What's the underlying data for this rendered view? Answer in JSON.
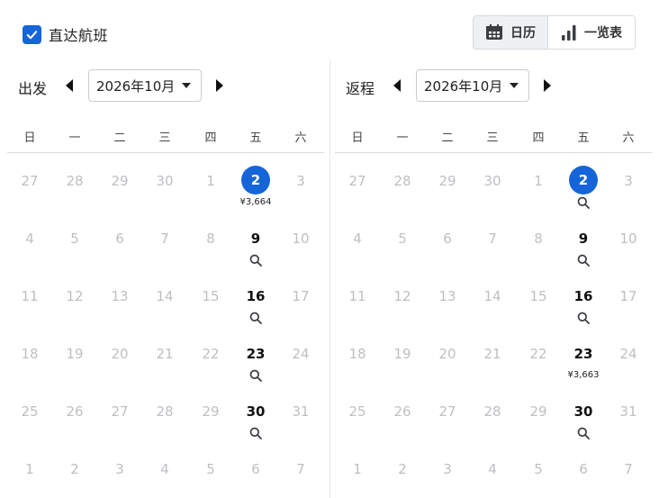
{
  "direct_flight": {
    "label": "直达航班",
    "checked": true
  },
  "view_toggle": {
    "calendar_label": "日历",
    "list_label": "一览表",
    "active": "calendar"
  },
  "weekdays": [
    "日",
    "一",
    "二",
    "三",
    "四",
    "五",
    "六"
  ],
  "panels": [
    {
      "label": "出发",
      "month": "2026年10月",
      "weeks": [
        [
          "27",
          "28",
          "29",
          "30",
          "1",
          "2",
          "3"
        ],
        [
          "4",
          "5",
          "6",
          "7",
          "8",
          "9",
          "10"
        ],
        [
          "11",
          "12",
          "13",
          "14",
          "15",
          "16",
          "17"
        ],
        [
          "18",
          "19",
          "20",
          "21",
          "22",
          "23",
          "24"
        ],
        [
          "25",
          "26",
          "27",
          "28",
          "29",
          "30",
          "31"
        ],
        [
          "1",
          "2",
          "3",
          "4",
          "5",
          "6",
          "7"
        ]
      ],
      "available": [
        [
          0,
          5
        ],
        [
          1,
          5
        ],
        [
          2,
          5
        ],
        [
          3,
          5
        ],
        [
          4,
          5
        ]
      ],
      "selected": [
        0,
        5
      ],
      "prices": [
        {
          "cell": [
            0,
            5
          ],
          "text": "¥3,664"
        }
      ]
    },
    {
      "label": "返程",
      "month": "2026年10月",
      "weeks": [
        [
          "27",
          "28",
          "29",
          "30",
          "1",
          "2",
          "3"
        ],
        [
          "4",
          "5",
          "6",
          "7",
          "8",
          "9",
          "10"
        ],
        [
          "11",
          "12",
          "13",
          "14",
          "15",
          "16",
          "17"
        ],
        [
          "18",
          "19",
          "20",
          "21",
          "22",
          "23",
          "24"
        ],
        [
          "25",
          "26",
          "27",
          "28",
          "29",
          "30",
          "31"
        ],
        [
          "1",
          "2",
          "3",
          "4",
          "5",
          "6",
          "7"
        ]
      ],
      "available": [
        [
          0,
          5
        ],
        [
          1,
          5
        ],
        [
          2,
          5
        ],
        [
          3,
          5
        ],
        [
          4,
          5
        ]
      ],
      "selected": [
        0,
        5
      ],
      "prices": [
        {
          "cell": [
            3,
            5
          ],
          "text": "¥3,663"
        }
      ]
    }
  ],
  "icons": {
    "checkbox": "check-icon",
    "calendar": "calendar-icon",
    "list": "bar-chart-icon",
    "prev": "triangle-left-icon",
    "next": "triangle-right-icon",
    "search": "magnifier-icon"
  },
  "colors": {
    "accent": "#1565d8",
    "muted_day": "#bdbfc3",
    "active_toggle_bg": "#eef0f3"
  }
}
